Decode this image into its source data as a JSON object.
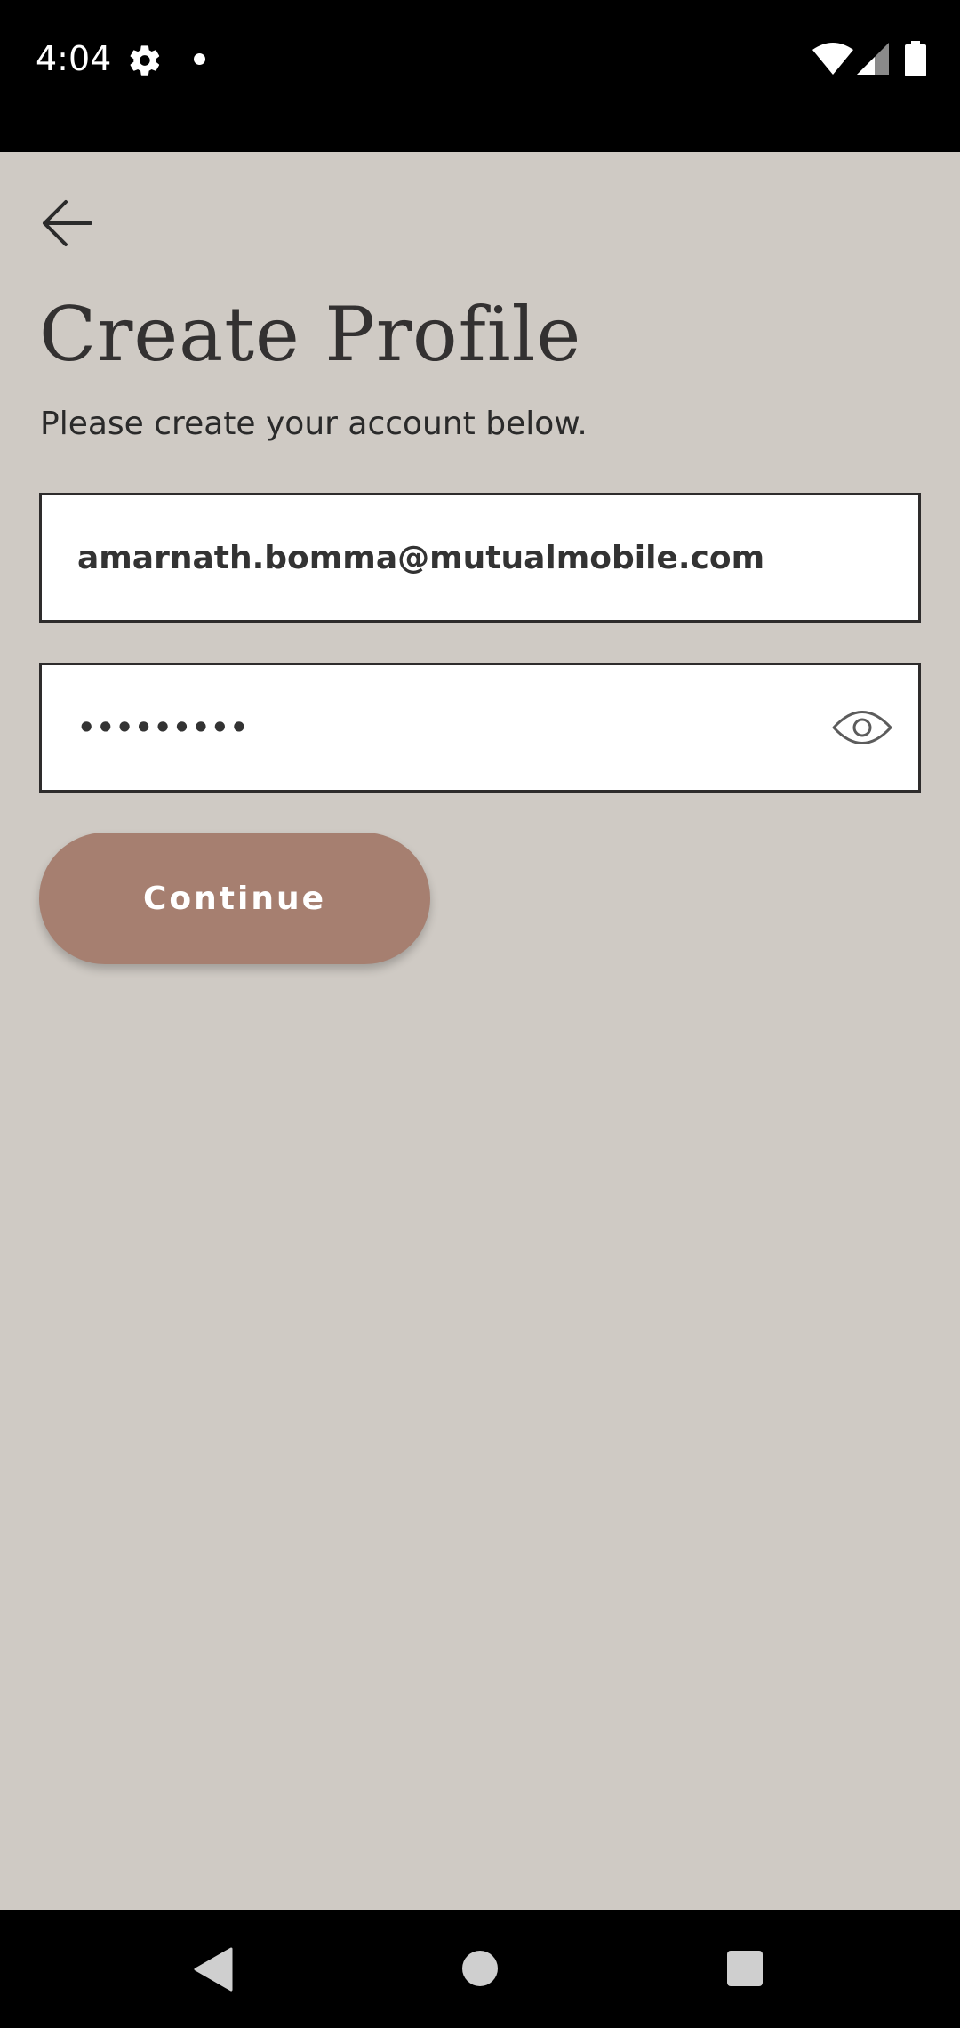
{
  "status_bar": {
    "time": "4:04",
    "icons": [
      "gear-icon",
      "notification-dot-icon",
      "wifi-icon",
      "signal-icon",
      "battery-icon"
    ]
  },
  "screen": {
    "back_icon": "arrow-left-icon",
    "title": "Create Profile",
    "subtitle": "Please create your account below."
  },
  "form": {
    "email": {
      "value": "amarnath.bomma@mutualmobile.com"
    },
    "password": {
      "value": "•••••••••",
      "toggle_icon": "eye-icon"
    },
    "continue_label": "Continue"
  },
  "nav_bar": {
    "icons": [
      "nav-back-icon",
      "nav-home-icon",
      "nav-recents-icon"
    ]
  },
  "colors": {
    "background": "#cfcac4",
    "button": "#a67f70",
    "title_text": "#333131",
    "field_border": "#2e2c2c"
  }
}
